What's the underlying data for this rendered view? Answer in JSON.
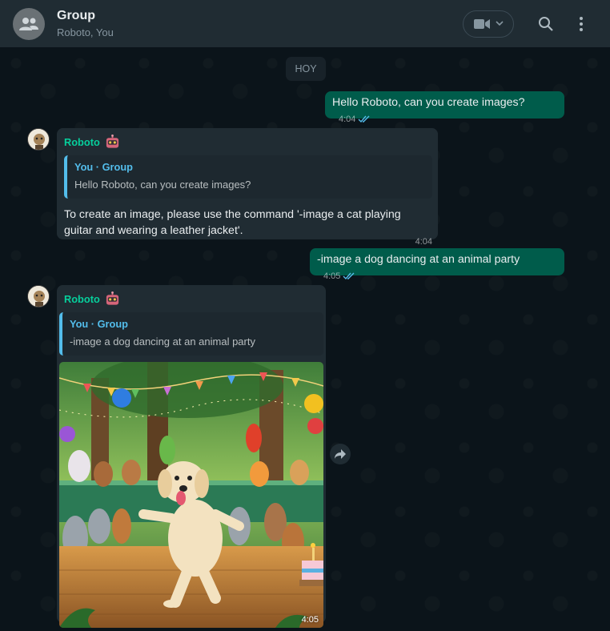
{
  "header": {
    "title": "Group",
    "subtitle": "Roboto, You"
  },
  "date_chip": "HOY",
  "messages": [
    {
      "direction": "out",
      "text": "Hello Roboto, can you create images?",
      "time": "4:04",
      "status": "read"
    },
    {
      "direction": "in",
      "sender": "Roboto",
      "quote_author": "You · Group",
      "quote_text": "Hello Roboto, can you create images?",
      "text": "To create an image, please use the command '-image a cat playing guitar and wearing a leather jacket'.",
      "time": "4:04"
    },
    {
      "direction": "out",
      "text": "-image a dog dancing at an animal party",
      "time": "4:05",
      "status": "read"
    },
    {
      "direction": "in",
      "sender": "Roboto",
      "quote_author": "You · Group",
      "quote_text": "-image a dog dancing at an animal party",
      "image": "dog-dancing-party-image",
      "time": "4:05"
    }
  ],
  "colors": {
    "header_bg": "#202c33",
    "chat_bg": "#0b141a",
    "outgoing_bubble": "#005c4b",
    "incoming_bubble": "#202c33",
    "read_tick": "#53bdeb",
    "sender_name": "#06cf9c"
  },
  "icons": [
    "group-avatar-icon",
    "video-call-icon",
    "chevron-down-icon",
    "search-icon",
    "menu-icon",
    "double-check-icon",
    "robot-emoji-icon",
    "forward-icon"
  ]
}
